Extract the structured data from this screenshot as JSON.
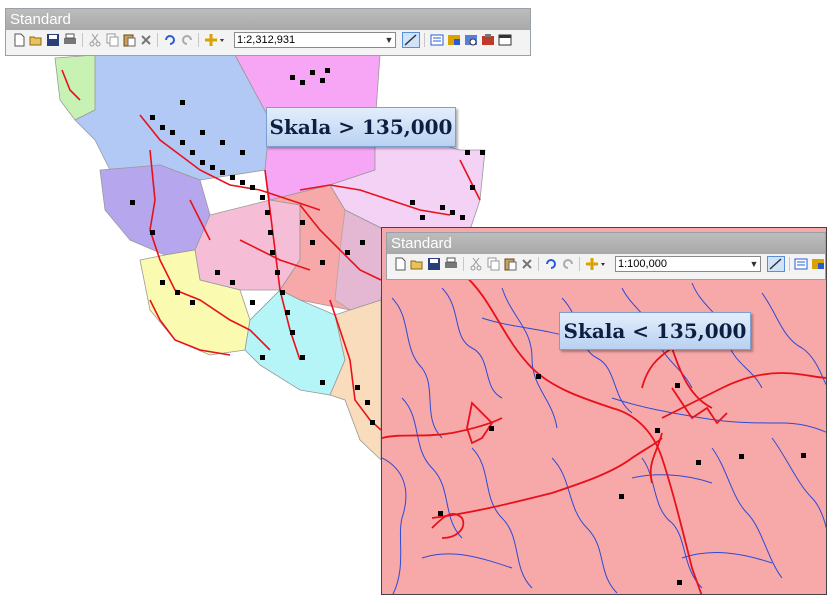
{
  "main_view": {
    "toolbar": {
      "title": "Standard",
      "scale_value": "1:2,312,931",
      "icons": [
        "new-document-icon",
        "open-folder-icon",
        "save-icon",
        "print-icon",
        "cut-icon",
        "copy-icon",
        "paste-icon",
        "delete-icon",
        "undo-icon",
        "redo-icon",
        "add-data-icon",
        "scale-dropdown",
        "editor-toolbar-icon",
        "table-of-contents-icon",
        "catalog-icon",
        "search-window-icon",
        "arctoolbox-icon",
        "python-window-icon"
      ]
    },
    "label": "Skala > 135,000"
  },
  "inset_view": {
    "toolbar": {
      "title": "Standard",
      "scale_value": "1:100,000"
    },
    "label": "Skala < 135,000"
  },
  "colors": {
    "road": "#e8111b",
    "river": "#2d4ad6",
    "point": "#000000",
    "inset_fill": "#f7a8a8",
    "label_text": "#0d1f40"
  },
  "legend_semantics": {
    "region_colors": [
      "#c8f2b4",
      "#b3c9f5",
      "#f6a6f4",
      "#b6a6ee",
      "#f3d2f5",
      "#f5bed6",
      "#f7a8a8",
      "#fafab0",
      "#b5f5f7",
      "#f8dcbc",
      "#d8c2f0"
    ]
  }
}
